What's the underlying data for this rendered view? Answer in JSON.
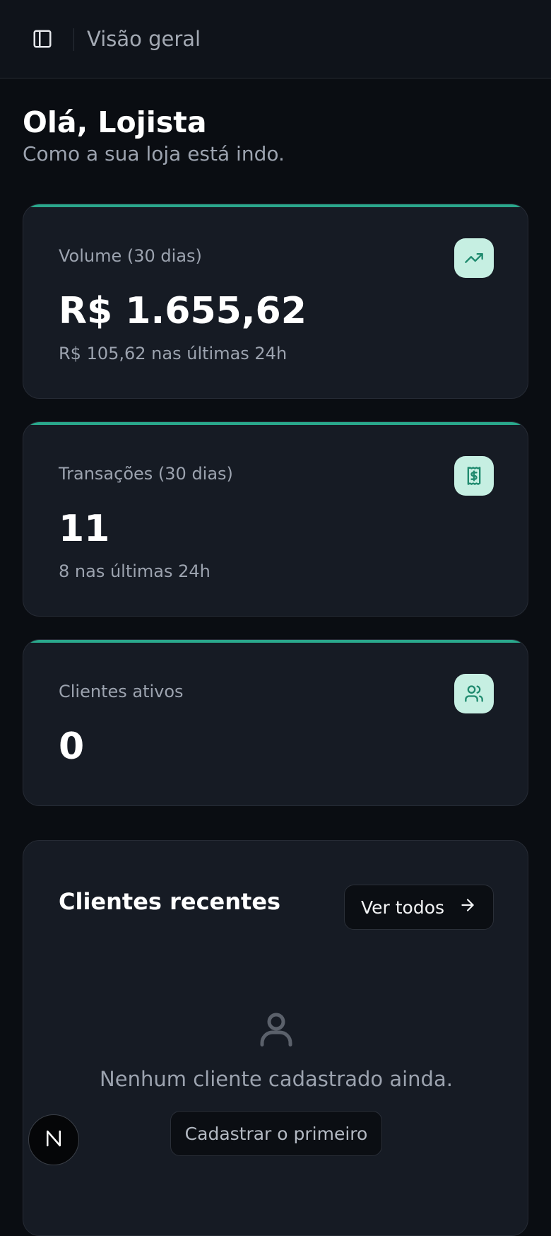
{
  "header": {
    "title": "Visão geral",
    "toggle_icon": "sidebar-toggle-icon"
  },
  "greeting": {
    "title": "Olá, Lojista",
    "subtitle": "Como a sua loja está indo."
  },
  "stats": [
    {
      "label": "Volume (30 dias)",
      "value": "R$ 1.655,62",
      "sub": "R$ 105,62 nas últimas 24h",
      "icon": "trending-up-icon"
    },
    {
      "label": "Transações (30 dias)",
      "value": "11",
      "sub": "8 nas últimas 24h",
      "icon": "receipt-icon"
    },
    {
      "label": "Clientes ativos",
      "value": "0",
      "icon": "users-icon"
    }
  ],
  "recent": {
    "title": "Clientes recentes",
    "view_all_label": "Ver todos",
    "empty_text": "Nenhum cliente cadastrado ainda.",
    "empty_cta": "Cadastrar o primeiro"
  },
  "colors": {
    "accent": "#2aa88c",
    "icon_bg": "#c6efe2",
    "icon_fg": "#1f8a6e",
    "background": "#0a0d12",
    "card": "#161b24"
  }
}
